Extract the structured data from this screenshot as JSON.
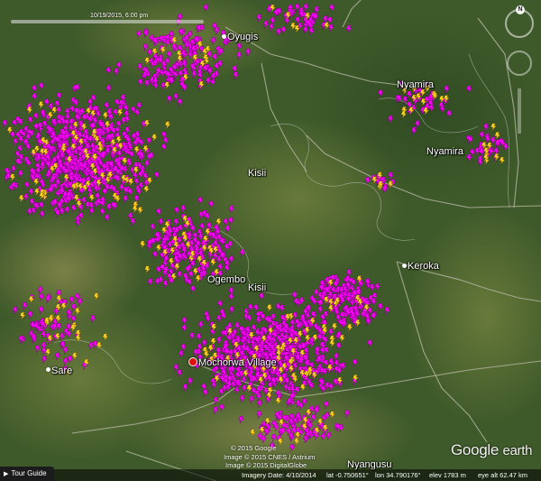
{
  "timeline": {
    "label": "10/19/2015, 6:00 pm"
  },
  "places": {
    "oyugis": "Oyugis",
    "nyamira_north": "Nyamira",
    "nyamira": "Nyamira",
    "kisii_top": "Kisii",
    "kisii": "Kisii",
    "keroka": "Keroka",
    "oyugis_partial": "Ogembo",
    "mochorwa": "Mochorwa Village",
    "sare": "Sare",
    "magongo": "Nyangusu"
  },
  "credits": {
    "google": "© 2015 Google",
    "cnes": "Image © 2015 CNES / Astrium",
    "digitalglobe": "Image © 2015 DigitalGlobe"
  },
  "brand": {
    "google": "Google",
    "earth": "earth"
  },
  "tour_guide": {
    "label": "Tour Guide"
  },
  "status": {
    "imagery_date": "Imagery Date: 4/10/2014",
    "lat": "lat  -0.750651°",
    "lon": "lon  34.790176°",
    "elev": "elev  1783 m",
    "eye_alt": "eye alt  62.47 km"
  },
  "nav": {
    "north": "N"
  },
  "colors": {
    "strike_cg": "#ff00ff",
    "strike_ic": "#ffd21f",
    "village_marker": "#e01010"
  },
  "icons": {
    "strike": "lightning-bolt-icon",
    "tour": "play-triangle-icon"
  }
}
